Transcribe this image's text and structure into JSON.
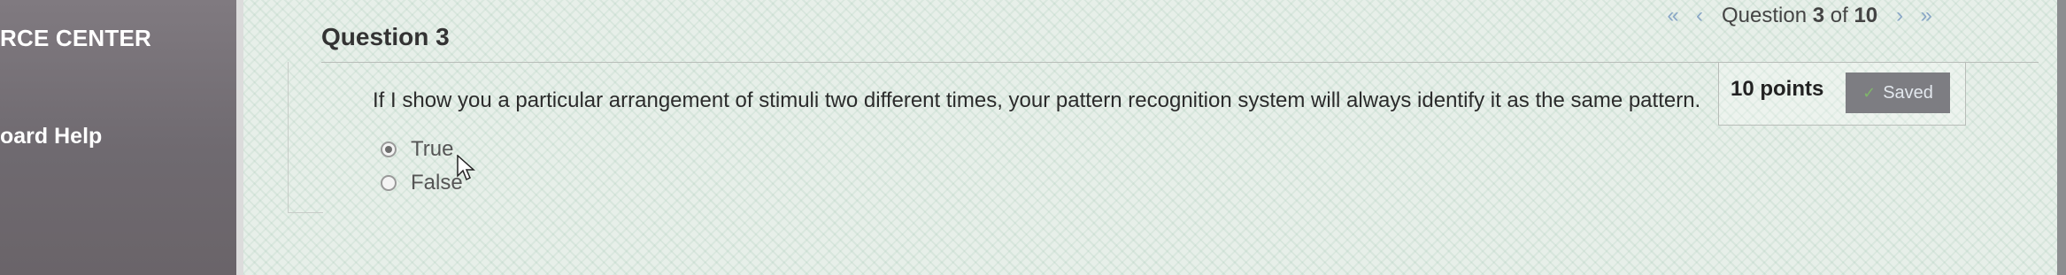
{
  "sidebar": {
    "title": "RCE CENTER",
    "help_label": "oard Help"
  },
  "question": {
    "title": "Question 3",
    "points": "10 points",
    "saved_label": "Saved",
    "text": "If I show you a particular arrangement of stimuli two different times, your pattern recognition system will always identify it as the same pattern.",
    "options": [
      "True",
      "False"
    ],
    "selected": "True"
  },
  "nav": {
    "first_icon": "double-chevron-left-icon",
    "prev_icon": "chevron-left-icon",
    "label_prefix": "Question ",
    "current": "3",
    "of_label": " of ",
    "total": "10",
    "next_icon": "chevron-right-icon",
    "last_icon": "double-chevron-right-icon"
  },
  "colors": {
    "sidebar": "#767077",
    "background": "#e7efe9",
    "saved_badge": "#7d7d82",
    "nav_icon": "#8aa7c6",
    "text": "#2b2b2b"
  }
}
